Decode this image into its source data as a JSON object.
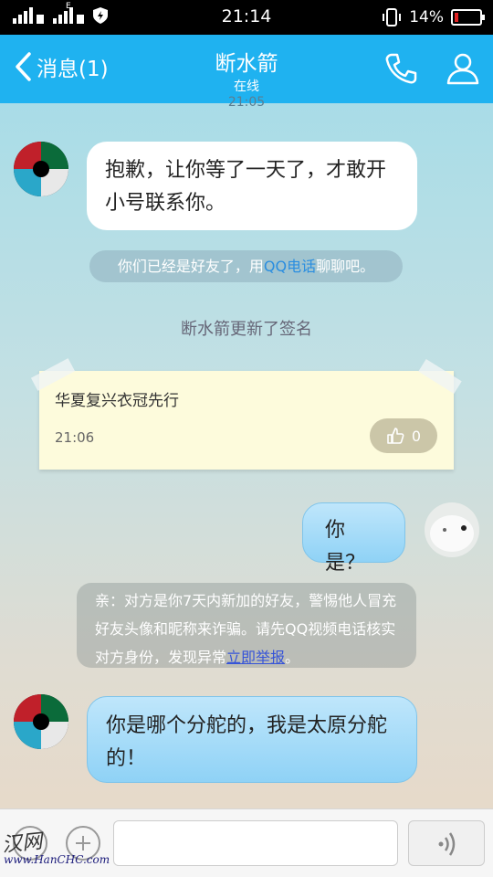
{
  "status_bar": {
    "time": "21:14",
    "battery": "14%",
    "battery_level": 0.14,
    "network_tag": "E"
  },
  "header": {
    "back_label": "消息(1)",
    "title": "断水箭",
    "subtitle": "在线"
  },
  "messages": {
    "cut_time": "21:05",
    "msg1_text": "抱歉，让你等了一天了，才敢开小号联系你。",
    "friend_hint": {
      "before": "你们已经是好友了，用",
      "link": "QQ电话",
      "after": "聊聊吧。"
    },
    "signature_notice": "断水箭更新了签名",
    "signature_card": {
      "text": "华夏复兴衣冠先行",
      "time": "21:06",
      "likes": "0"
    },
    "msg2_text": "你是？",
    "warning": {
      "text": "亲：对方是你7天内新加的好友，警惕他人冒充好友头像和昵称来诈骗。请先QQ视频电话核实对方身份，发现异常",
      "link": "立即举报",
      "end": "。"
    },
    "msg3_text": "你是哪个分舵的，我是太原分舵的！"
  },
  "input_bar": {
    "value": "",
    "watermark_text": "汉网",
    "watermark_url": "www.HanCHC.com"
  },
  "colors": {
    "header_bg": "#1fb2f0",
    "link": "#2b8ee0",
    "battery_low": "#e02424"
  },
  "icons": [
    "back-chevron-icon",
    "phone-icon",
    "profile-icon",
    "emoji-icon",
    "plus-icon",
    "voice-icon",
    "thumbs-up-icon",
    "shield-icon",
    "signal-icon"
  ]
}
